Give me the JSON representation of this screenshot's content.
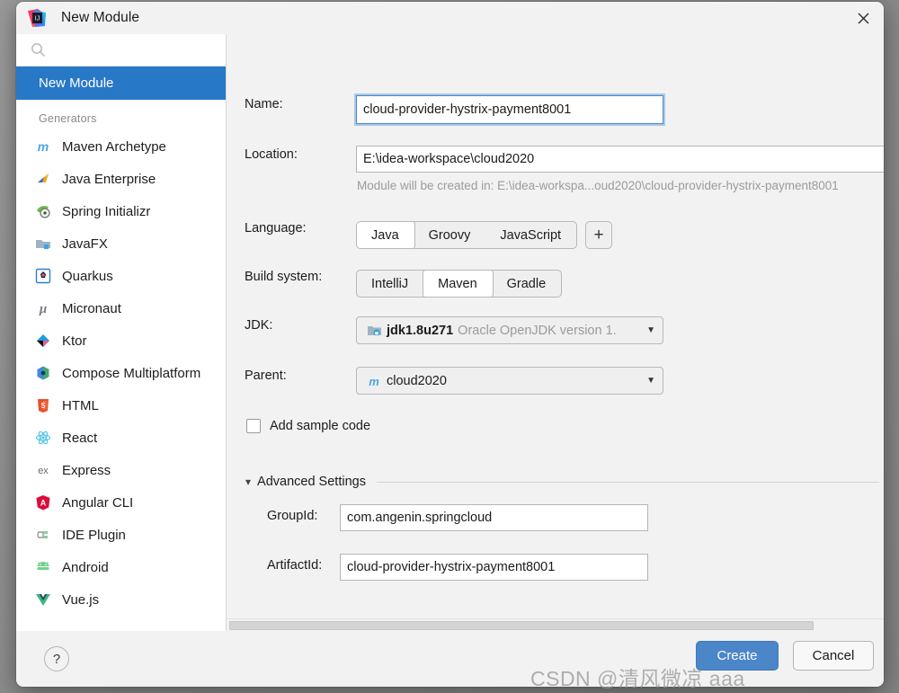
{
  "window": {
    "title": "New Module",
    "app_icon": "intellij-idea-icon",
    "close_label": "✕"
  },
  "sidebar": {
    "search": {
      "value": "",
      "placeholder": "",
      "icon": "search-icon"
    },
    "selected_item": "New Module",
    "group_label": "Generators",
    "generators": [
      {
        "label": "Maven Archetype",
        "icon": "maven-icon"
      },
      {
        "label": "Java Enterprise",
        "icon": "java-enterprise-icon"
      },
      {
        "label": "Spring Initializr",
        "icon": "spring-icon"
      },
      {
        "label": "JavaFX",
        "icon": "javafx-icon"
      },
      {
        "label": "Quarkus",
        "icon": "quarkus-icon"
      },
      {
        "label": "Micronaut",
        "icon": "micronaut-icon"
      },
      {
        "label": "Ktor",
        "icon": "ktor-icon"
      },
      {
        "label": "Compose Multiplatform",
        "icon": "compose-icon"
      },
      {
        "label": "HTML",
        "icon": "html5-icon"
      },
      {
        "label": "React",
        "icon": "react-icon"
      },
      {
        "label": "Express",
        "icon": "express-icon"
      },
      {
        "label": "Angular CLI",
        "icon": "angular-icon"
      },
      {
        "label": "IDE Plugin",
        "icon": "plugin-icon"
      },
      {
        "label": "Android",
        "icon": "android-icon"
      },
      {
        "label": "Vue.js",
        "icon": "vue-icon"
      }
    ]
  },
  "form": {
    "name": {
      "label": "Name:",
      "value": "cloud-provider-hystrix-payment8001"
    },
    "location": {
      "label": "Location:",
      "value": "E:\\idea-workspace\\cloud2020"
    },
    "location_hint": "Module will be created in: E:\\idea-workspa...oud2020\\cloud-provider-hystrix-payment8001",
    "language": {
      "label": "Language:",
      "options": [
        "Java",
        "Groovy",
        "JavaScript"
      ],
      "selected": "Java",
      "add_label": "+"
    },
    "build_system": {
      "label": "Build system:",
      "options": [
        "IntelliJ",
        "Maven",
        "Gradle"
      ],
      "selected": "Maven"
    },
    "jdk": {
      "label": "JDK:",
      "value": "jdk1.8u271",
      "detail": "Oracle OpenJDK version 1.",
      "icon": "jdk-folder-icon"
    },
    "parent": {
      "label": "Parent:",
      "value": "cloud2020",
      "icon": "maven-icon"
    },
    "add_sample_code": {
      "label": "Add sample code",
      "checked": false
    },
    "advanced": {
      "title": "Advanced Settings",
      "expanded": true,
      "group_id": {
        "label": "GroupId:",
        "value": "com.angenin.springcloud"
      },
      "artifact_id": {
        "label": "ArtifactId:",
        "value": "cloud-provider-hystrix-payment8001"
      }
    }
  },
  "footer": {
    "help_label": "?",
    "create_label": "Create",
    "cancel_label": "Cancel"
  },
  "watermark": "CSDN @清风微凉 aaa",
  "colors": {
    "selection_blue": "#2878c8",
    "primary_button": "#4a86c8",
    "dialog_bg": "#f2f2f2",
    "sidebar_bg": "#ffffff",
    "focus_border": "#4b88c5"
  }
}
